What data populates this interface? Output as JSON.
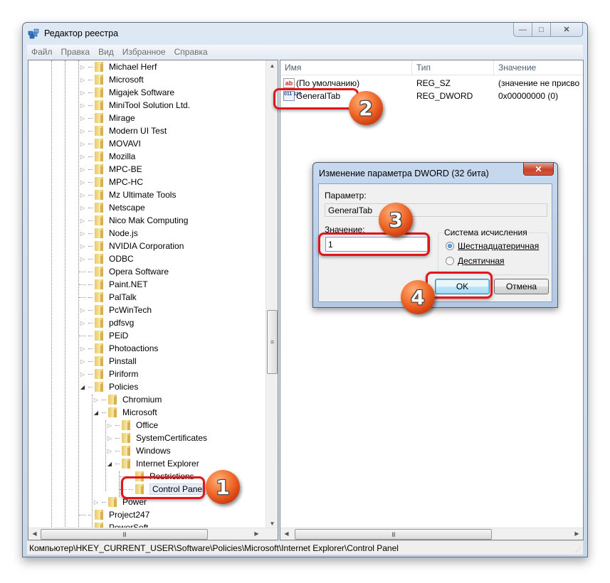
{
  "window": {
    "title": "Редактор реестра",
    "caption_buttons": {
      "minimize": "—",
      "maximize": "□",
      "close": "✕"
    }
  },
  "menu": [
    "Файл",
    "Правка",
    "Вид",
    "Избранное",
    "Справка"
  ],
  "tree": {
    "items": [
      {
        "label": "Michael Herf",
        "level": 0,
        "expander": "collapsed"
      },
      {
        "label": "Microsoft",
        "level": 0,
        "expander": "collapsed"
      },
      {
        "label": "Migajek Software",
        "level": 0,
        "expander": "collapsed"
      },
      {
        "label": "MiniTool Solution Ltd.",
        "level": 0,
        "expander": "collapsed"
      },
      {
        "label": "Mirage",
        "level": 0,
        "expander": "collapsed"
      },
      {
        "label": "Modern UI Test",
        "level": 0,
        "expander": "collapsed"
      },
      {
        "label": "MOVAVI",
        "level": 0,
        "expander": "collapsed"
      },
      {
        "label": "Mozilla",
        "level": 0,
        "expander": "collapsed"
      },
      {
        "label": "MPC-BE",
        "level": 0,
        "expander": "collapsed"
      },
      {
        "label": "MPC-HC",
        "level": 0,
        "expander": "collapsed"
      },
      {
        "label": "Mz Ultimate Tools",
        "level": 0,
        "expander": "collapsed"
      },
      {
        "label": "Netscape",
        "level": 0,
        "expander": "collapsed"
      },
      {
        "label": "Nico Mak Computing",
        "level": 0,
        "expander": "collapsed"
      },
      {
        "label": "Node.js",
        "level": 0,
        "expander": "collapsed"
      },
      {
        "label": "NVIDIA Corporation",
        "level": 0,
        "expander": "collapsed"
      },
      {
        "label": "ODBC",
        "level": 0,
        "expander": "collapsed"
      },
      {
        "label": "Opera Software",
        "level": 0,
        "expander": "none"
      },
      {
        "label": "Paint.NET",
        "level": 0,
        "expander": "none"
      },
      {
        "label": "PalTalk",
        "level": 0,
        "expander": "none"
      },
      {
        "label": "PcWinTech",
        "level": 0,
        "expander": "collapsed"
      },
      {
        "label": "pdfsvg",
        "level": 0,
        "expander": "collapsed"
      },
      {
        "label": "PEiD",
        "level": 0,
        "expander": "none"
      },
      {
        "label": "Photoactions",
        "level": 0,
        "expander": "collapsed"
      },
      {
        "label": "Pinstall",
        "level": 0,
        "expander": "collapsed"
      },
      {
        "label": "Piriform",
        "level": 0,
        "expander": "collapsed"
      },
      {
        "label": "Policies",
        "level": 0,
        "expander": "expanded"
      },
      {
        "label": "Chromium",
        "level": 1,
        "expander": "collapsed"
      },
      {
        "label": "Microsoft",
        "level": 1,
        "expander": "expanded"
      },
      {
        "label": "Office",
        "level": 2,
        "expander": "collapsed"
      },
      {
        "label": "SystemCertificates",
        "level": 2,
        "expander": "collapsed"
      },
      {
        "label": "Windows",
        "level": 2,
        "expander": "collapsed"
      },
      {
        "label": "Internet Explorer",
        "level": 2,
        "expander": "expanded"
      },
      {
        "label": "Restrictions",
        "level": 3,
        "expander": "none"
      },
      {
        "label": "Control Panel",
        "level": 3,
        "expander": "none",
        "selected": true
      },
      {
        "label": "Power",
        "level": 1,
        "expander": "collapsed"
      },
      {
        "label": "Project247",
        "level": 0,
        "expander": "none"
      },
      {
        "label": "PowerSoft",
        "level": 0,
        "expander": "none"
      }
    ]
  },
  "list": {
    "columns": [
      "Имя",
      "Тип",
      "Значение"
    ],
    "rows": [
      {
        "icon": "string-value-icon",
        "icon_text": "ab",
        "name": "(По умолчанию)",
        "type": "REG_SZ",
        "value": "(значение не присво"
      },
      {
        "icon": "binary-value-icon",
        "icon_text": "011 110",
        "name": "GeneralTab",
        "type": "REG_DWORD",
        "value": "0x00000000 (0)"
      }
    ]
  },
  "statusbar": {
    "path": "Компьютер\\HKEY_CURRENT_USER\\Software\\Policies\\Microsoft\\Internet Explorer\\Control Panel"
  },
  "dialog": {
    "title": "Изменение параметра DWORD (32 бита)",
    "close": "✕",
    "param_label": "Параметр:",
    "param_value": "GeneralTab",
    "value_label": "Значение:",
    "value": "1",
    "base_group_title": "Система исчисления",
    "base_options": [
      {
        "label": "Шестнадцатеричная",
        "checked": true
      },
      {
        "label": "Десятичная",
        "checked": false
      }
    ],
    "ok_label": "OK",
    "cancel_label": "Отмена"
  },
  "annotations": {
    "step_badges": [
      "1",
      "2",
      "3",
      "4"
    ],
    "highlight_color": "#e0161b",
    "badge_color": "#f06a2b"
  }
}
